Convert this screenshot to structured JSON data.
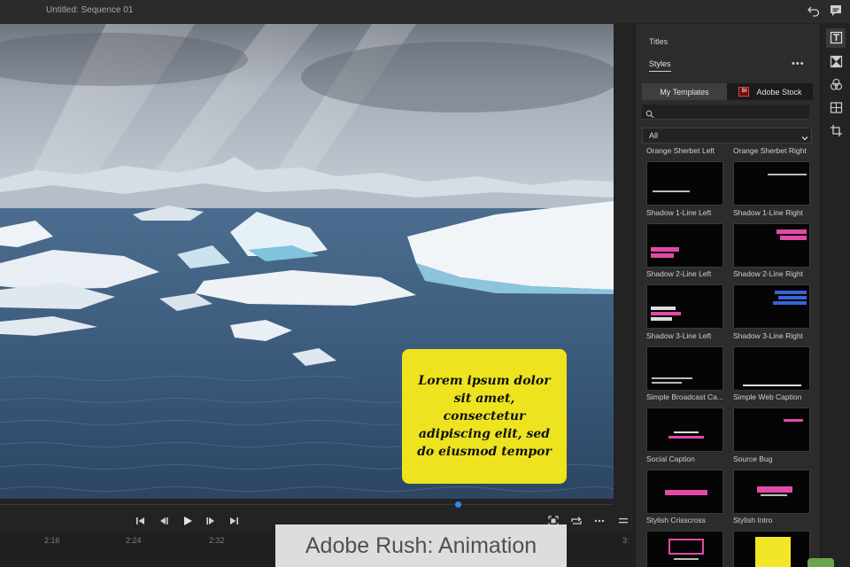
{
  "window": {
    "title": "Untitled: Sequence 01"
  },
  "preview": {
    "caption_text": "Lorem ipsum dolor sit amet, consectetur adipiscing elit, sed do eiusmod tempor",
    "caption_color": "#ede31f"
  },
  "timeline": {
    "ticks": [
      "2:16",
      "2:24",
      "2:32",
      "3:"
    ]
  },
  "overlay": {
    "label": "Adobe Rush: Animation"
  },
  "panel": {
    "title": "Titles",
    "active_tab": "Styles",
    "more_icon": "•••",
    "segments": {
      "left": "My Templates",
      "right": "Adobe Stock",
      "stock_badge": "St"
    },
    "search": {
      "placeholder": "",
      "value": ""
    },
    "filter": {
      "value": "All"
    },
    "templates": [
      {
        "name": "Orange Sherbet Left",
        "thumb": "bar-left-small",
        "thumb_text": ""
      },
      {
        "name": "Orange Sherbet Right",
        "thumb": "bar-right-small",
        "thumb_text": ""
      },
      {
        "name": "Shadow 1-Line Left",
        "thumb": "pink-left-1"
      },
      {
        "name": "Shadow 1-Line Right",
        "thumb": "pink-right-1"
      },
      {
        "name": "Shadow 2-Line Left",
        "thumb": "pink-left-2"
      },
      {
        "name": "Shadow 2-Line Right",
        "thumb": "blue-right-2"
      },
      {
        "name": "Shadow 3-Line Left",
        "thumb": "white-left-3"
      },
      {
        "name": "Shadow 3-Line Right",
        "thumb": "white-bottom"
      },
      {
        "name": "Simple Broadcast Ca...",
        "thumb": "white-center-2"
      },
      {
        "name": "Simple Web Caption",
        "thumb": "pink-tiny-top"
      },
      {
        "name": "Social Caption",
        "thumb": "pink-bar-center"
      },
      {
        "name": "Source Bug",
        "thumb": "pink-bar-block"
      },
      {
        "name": "Stylish Crisscross",
        "thumb": "pink-frame"
      },
      {
        "name": "Stylish Intro",
        "thumb": "yellow-box"
      }
    ],
    "colors": {
      "accent_pink": "#e24aa8",
      "accent_blue": "#3a63d6",
      "accent_yellow": "#f2e626"
    }
  },
  "rail": {
    "icons": [
      "text-styles-icon",
      "transitions-icon",
      "color-icon",
      "layout-icon",
      "crop-icon"
    ]
  },
  "top_icons": [
    "undo-icon",
    "comment-icon"
  ]
}
